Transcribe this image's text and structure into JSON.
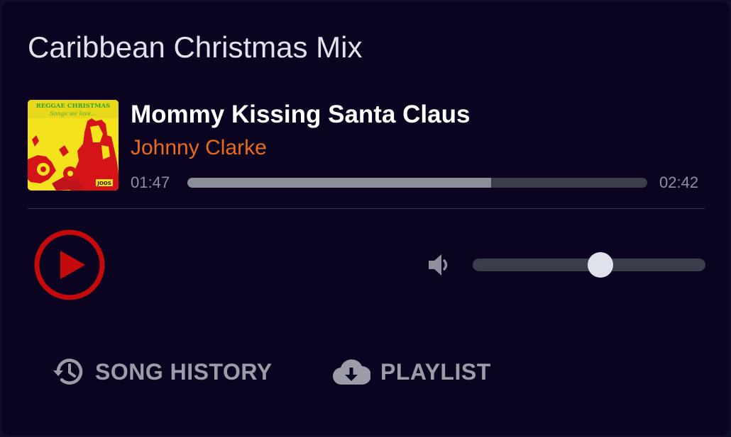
{
  "header": {
    "title": "Caribbean Christmas Mix"
  },
  "now_playing": {
    "song_title": "Mommy Kissing Santa Claus",
    "artist": "Johnny Clarke",
    "elapsed": "01:47",
    "duration": "02:42",
    "progress_fraction": 0.66,
    "album_art_text": {
      "line1": "REGGAE CHRISTMAS",
      "line2": "Songs we love..."
    }
  },
  "controls": {
    "play_icon": "play-circle-icon",
    "volume_icon": "speaker-icon",
    "volume_fraction": 0.55
  },
  "actions": {
    "history_label": "SONG HISTORY",
    "history_icon": "history-icon",
    "playlist_label": "PLAYLIST",
    "playlist_icon": "cloud-download-icon"
  },
  "colors": {
    "background": "#0b0420",
    "artist_accent": "#e86b1f",
    "play_red": "#c40a0a",
    "album_yellow": "#f5e11a"
  }
}
